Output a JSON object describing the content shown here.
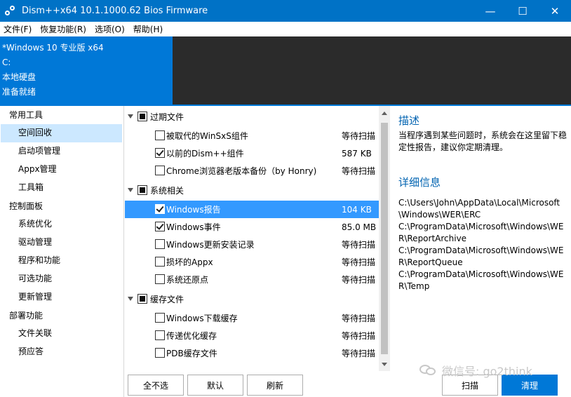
{
  "window": {
    "title": "Dism++x64 10.1.1000.62 Bios Firmware",
    "controls": [
      "—",
      "☐",
      "✕"
    ]
  },
  "menu": [
    "文件(F)",
    "恢复功能(R)",
    "选项(O)",
    "帮助(H)"
  ],
  "info": {
    "os": "*Windows 10 专业版 x64",
    "drive": "C:",
    "disk": "本地硬盘",
    "status": "准备就绪"
  },
  "sidebar": [
    {
      "type": "group",
      "label": "常用工具"
    },
    {
      "type": "item",
      "label": "空间回收",
      "active": true
    },
    {
      "type": "item",
      "label": "启动项管理"
    },
    {
      "type": "item",
      "label": "Appx管理"
    },
    {
      "type": "item",
      "label": "工具箱"
    },
    {
      "type": "group",
      "label": "控制面板"
    },
    {
      "type": "item",
      "label": "系统优化"
    },
    {
      "type": "item",
      "label": "驱动管理"
    },
    {
      "type": "item",
      "label": "程序和功能"
    },
    {
      "type": "item",
      "label": "可选功能"
    },
    {
      "type": "item",
      "label": "更新管理"
    },
    {
      "type": "group",
      "label": "部署功能"
    },
    {
      "type": "item",
      "label": "文件关联"
    },
    {
      "type": "item",
      "label": "预应答"
    }
  ],
  "cleanup": [
    {
      "group": "过期文件",
      "items": [
        {
          "label": "被取代的WinSxS组件",
          "value": "等待扫描",
          "checked": false
        },
        {
          "label": "以前的Dism++组件",
          "value": "587 KB",
          "checked": true
        },
        {
          "label": "Chrome浏览器老版本备份（by Honry)",
          "value": "等待扫描",
          "checked": false
        }
      ]
    },
    {
      "group": "系统相关",
      "items": [
        {
          "label": "Windows报告",
          "value": "104 KB",
          "checked": true,
          "selected": true
        },
        {
          "label": "Windows事件",
          "value": "85.0 MB",
          "checked": true
        },
        {
          "label": "Windows更新安装记录",
          "value": "等待扫描",
          "checked": false
        },
        {
          "label": "损坏的Appx",
          "value": "等待扫描",
          "checked": false
        },
        {
          "label": "系统还原点",
          "value": "等待扫描",
          "checked": false
        }
      ]
    },
    {
      "group": "缓存文件",
      "items": [
        {
          "label": "Windows下载缓存",
          "value": "等待扫描",
          "checked": false
        },
        {
          "label": "传递优化缓存",
          "value": "等待扫描",
          "checked": false
        },
        {
          "label": "PDB缓存文件",
          "value": "等待扫描",
          "checked": false
        }
      ]
    }
  ],
  "description": {
    "heading": "描述",
    "text": "当程序遇到某些问题时，系统会在这里留下稳定性报告，建议你定期清理。",
    "details_heading": "详细信息",
    "paths": [
      "C:\\Users\\John\\AppData\\Local\\Microsoft\\Windows\\WER\\ERC",
      "C:\\ProgramData\\Microsoft\\Windows\\WER\\ReportArchive",
      "C:\\ProgramData\\Microsoft\\Windows\\WER\\ReportQueue",
      "C:\\ProgramData\\Microsoft\\Windows\\WER\\Temp"
    ]
  },
  "buttons": {
    "deselect_all": "全不选",
    "default": "默认",
    "refresh": "刷新",
    "scan": "扫描",
    "clean": "清理"
  },
  "watermark": "微信号: go2think"
}
